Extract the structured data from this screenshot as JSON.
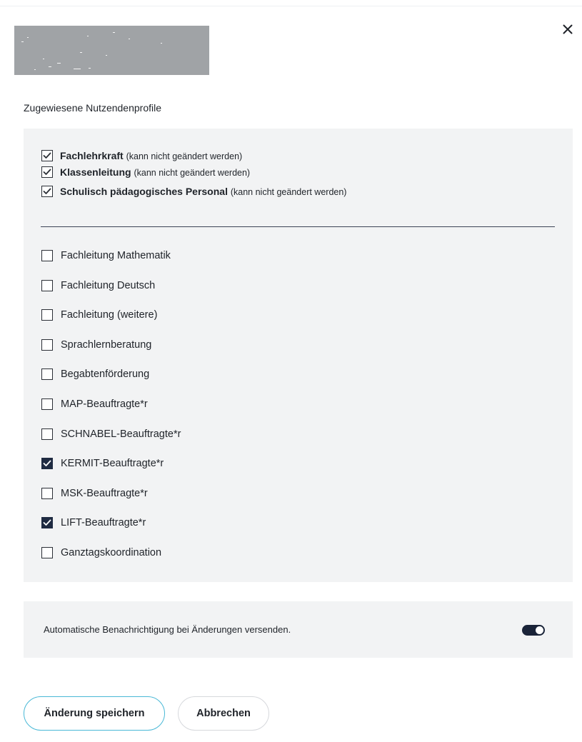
{
  "dialog": {
    "close_icon": "close-icon",
    "section_label": "Zugewiesene Nutzendenprofile"
  },
  "fixed_profiles": [
    {
      "name": "Fachlehrkraft",
      "note": "(kann nicht geändert werden)",
      "checked": true
    },
    {
      "name": "Klassenleitung",
      "note": "(kann nicht geändert werden)",
      "checked": true
    },
    {
      "name": "Schulisch pädagogisches Personal",
      "note": "(kann nicht geändert werden)",
      "checked": true
    }
  ],
  "optional_profiles": [
    {
      "label": "Fachleitung Mathematik",
      "checked": false
    },
    {
      "label": "Fachleitung Deutsch",
      "checked": false
    },
    {
      "label": "Fachleitung (weitere)",
      "checked": false
    },
    {
      "label": "Sprachlernberatung",
      "checked": false
    },
    {
      "label": "Begabtenförderung",
      "checked": false
    },
    {
      "label": "MAP-Beauftragte*r",
      "checked": false
    },
    {
      "label": "SCHNABEL-Beauftragte*r",
      "checked": false
    },
    {
      "label": "KERMIT-Beauftragte*r",
      "checked": true
    },
    {
      "label": "MSK-Beauftragte*r",
      "checked": false
    },
    {
      "label": "LIFT-Beauftragte*r",
      "checked": true
    },
    {
      "label": "Ganztagskoordination",
      "checked": false
    }
  ],
  "notification": {
    "label": "Automatische Benachrichtigung bei Änderungen versenden.",
    "enabled": true
  },
  "actions": {
    "save_label": "Änderung speichern",
    "cancel_label": "Abbrechen"
  },
  "colors": {
    "panel_bg": "#f2f3f4",
    "checkbox_filled": "#1f2b42",
    "save_border": "#49b8d6",
    "cancel_border": "#d6d8dc",
    "toggle_on": "#1a2338"
  }
}
